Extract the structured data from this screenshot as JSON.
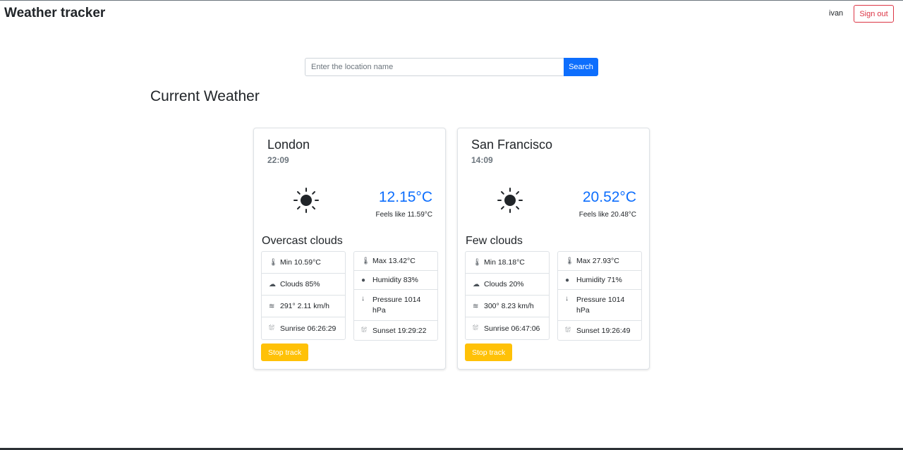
{
  "navbar": {
    "brand": "Weather tracker",
    "username": "ivan",
    "signout_label": "Sign out"
  },
  "search": {
    "placeholder": "Enter the location name",
    "button_label": "Search"
  },
  "section_title": "Current Weather",
  "colors": {
    "primary": "#0d6efd",
    "danger": "#dc3545",
    "warning": "#ffc107"
  },
  "cards": [
    {
      "city": "London",
      "time": "22:09",
      "icon": "sun-icon",
      "temp": "12.15°C",
      "feels_like": "Feels like 11.59°C",
      "description": "Overcast clouds",
      "left_items": [
        {
          "icon": "thermometer-icon",
          "text": "Min 10.59°C"
        },
        {
          "icon": "cloud-icon",
          "text": "Clouds 85%"
        },
        {
          "icon": "wind-icon",
          "text": "291° 2.11 km/h"
        },
        {
          "icon": "sunrise-icon",
          "text": "Sunrise 06:26:29"
        }
      ],
      "right_items": [
        {
          "icon": "thermometer-icon",
          "text": "Max 13.42°C"
        },
        {
          "icon": "droplet-icon",
          "text": "Humidity 83%"
        },
        {
          "icon": "arrow-down-icon",
          "text": "Pressure 1014 hPa"
        },
        {
          "icon": "sunset-icon",
          "text": "Sunset 19:29:22"
        }
      ],
      "button_label": "Stop track"
    },
    {
      "city": "San Francisco",
      "time": "14:09",
      "icon": "sun-icon",
      "temp": "20.52°C",
      "feels_like": "Feels like 20.48°C",
      "description": "Few clouds",
      "left_items": [
        {
          "icon": "thermometer-icon",
          "text": "Min 18.18°C"
        },
        {
          "icon": "cloud-icon",
          "text": "Clouds 20%"
        },
        {
          "icon": "wind-icon",
          "text": "300° 8.23 km/h"
        },
        {
          "icon": "sunrise-icon",
          "text": "Sunrise 06:47:06"
        }
      ],
      "right_items": [
        {
          "icon": "thermometer-icon",
          "text": "Max 27.93°C"
        },
        {
          "icon": "droplet-icon",
          "text": "Humidity 71%"
        },
        {
          "icon": "arrow-down-icon",
          "text": "Pressure 1014 hPa"
        },
        {
          "icon": "sunset-icon",
          "text": "Sunset 19:26:49"
        }
      ],
      "button_label": "Stop track"
    }
  ]
}
